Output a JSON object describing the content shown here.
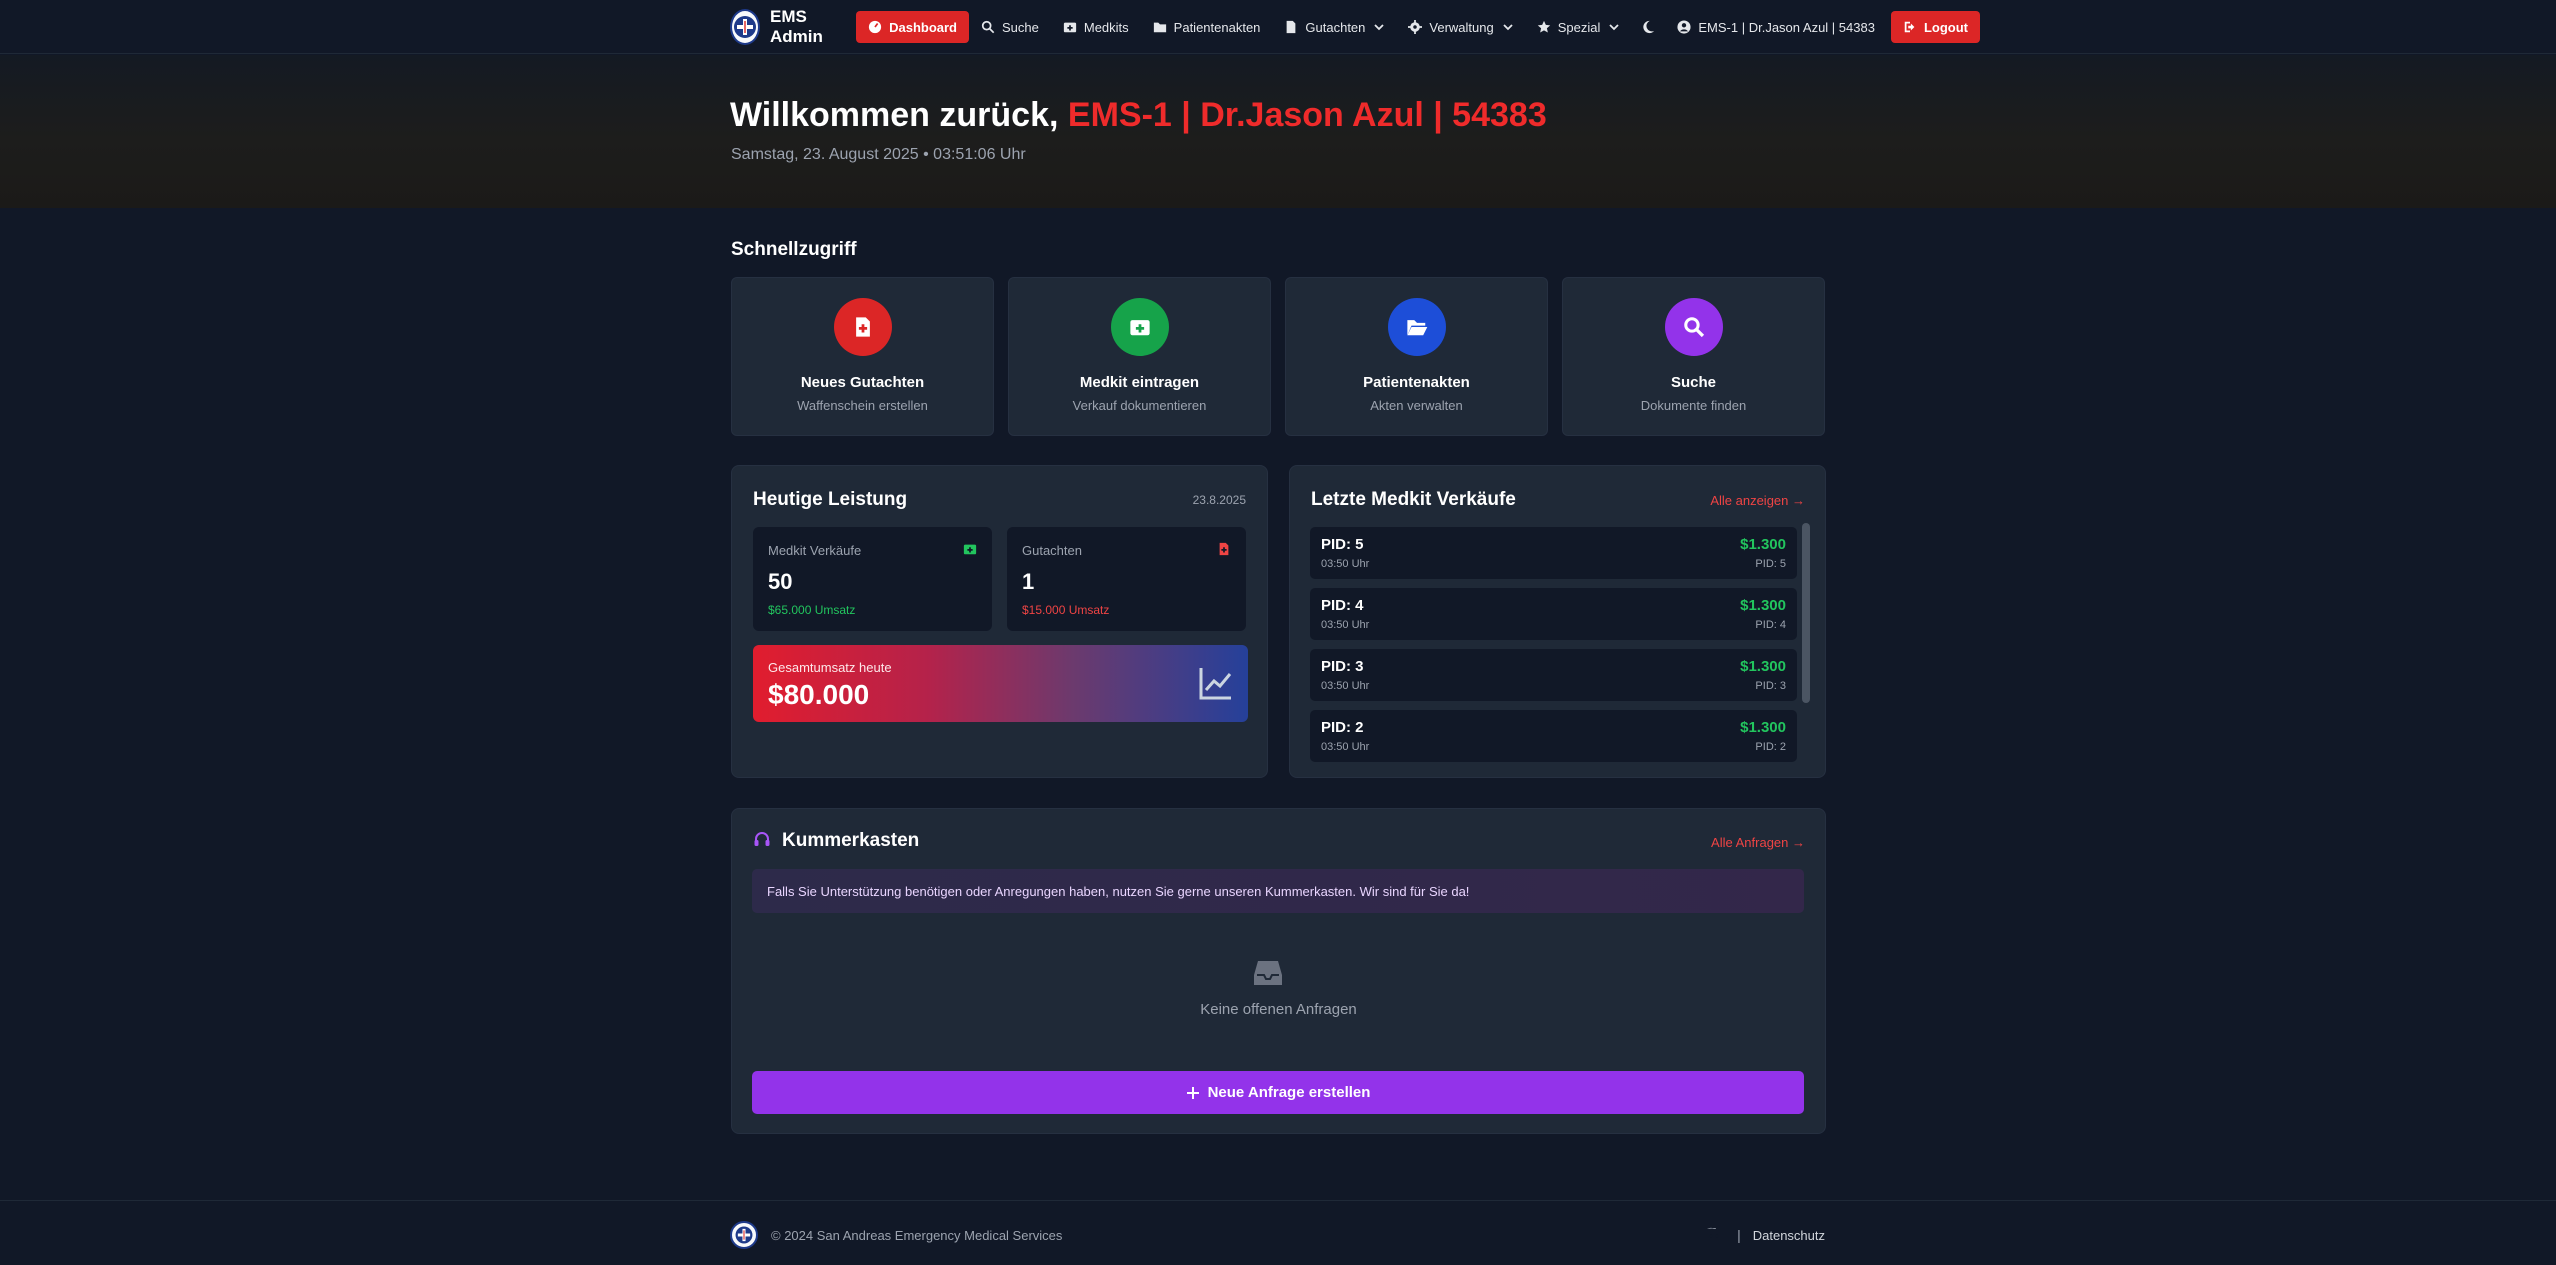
{
  "nav": {
    "brand": "EMS Admin",
    "items": [
      {
        "label": "Dashboard",
        "icon": "dashboard-icon",
        "active": true
      },
      {
        "label": "Suche",
        "icon": "search-icon"
      },
      {
        "label": "Medkits",
        "icon": "medkit-icon"
      },
      {
        "label": "Patientenakten",
        "icon": "folder-icon"
      },
      {
        "label": "Gutachten",
        "icon": "file-icon",
        "dropdown": true
      },
      {
        "label": "Verwaltung",
        "icon": "gear-icon",
        "dropdown": true
      },
      {
        "label": "Spezial",
        "icon": "star-icon",
        "dropdown": true
      }
    ],
    "user": "EMS-1 | Dr.Jason Azul | 54383",
    "logout": "Logout"
  },
  "hero": {
    "greeting": "Willkommen zurück,",
    "name": "EMS-1 | Dr.Jason Azul | 54383",
    "datetime": "Samstag, 23. August 2025 • 03:51:06 Uhr"
  },
  "quick": {
    "title": "Schnellzugriff",
    "cards": [
      {
        "title": "Neues Gutachten",
        "subtitle": "Waffenschein erstellen",
        "icon": "file-plus-icon",
        "color": "#dc2626"
      },
      {
        "title": "Medkit eintragen",
        "subtitle": "Verkauf dokumentieren",
        "icon": "medkit-icon",
        "color": "#16a34a"
      },
      {
        "title": "Patientenakten",
        "subtitle": "Akten verwalten",
        "icon": "folder-open-icon",
        "color": "#1d4ed8"
      },
      {
        "title": "Suche",
        "subtitle": "Dokumente finden",
        "icon": "search-icon",
        "color": "#9333ea"
      }
    ]
  },
  "today": {
    "title": "Heutige Leistung",
    "date": "23.8.2025",
    "medkit": {
      "label": "Medkit Verkäufe",
      "value": "50",
      "revenue": "$65.000 Umsatz"
    },
    "gutachten": {
      "label": "Gutachten",
      "value": "1",
      "revenue": "$15.000 Umsatz"
    },
    "total": {
      "label": "Gesamtumsatz heute",
      "value": "$80.000"
    }
  },
  "sales": {
    "title": "Letzte Medkit Verkäufe",
    "link": "Alle anzeigen →",
    "items": [
      {
        "pid": "PID: 5",
        "time": "03:50 Uhr",
        "amount": "$1.300",
        "pid_small": "PID: 5"
      },
      {
        "pid": "PID: 4",
        "time": "03:50 Uhr",
        "amount": "$1.300",
        "pid_small": "PID: 4"
      },
      {
        "pid": "PID: 3",
        "time": "03:50 Uhr",
        "amount": "$1.300",
        "pid_small": "PID: 3"
      },
      {
        "pid": "PID: 2",
        "time": "03:50 Uhr",
        "amount": "$1.300",
        "pid_small": "PID: 2"
      }
    ]
  },
  "kummer": {
    "title": "Kummerkasten",
    "link": "Alle Anfragen →",
    "notice": "Falls Sie Unterstützung benötigen oder Anregungen haben, nutzen Sie gerne unseren Kummerkasten. Wir sind für Sie da!",
    "empty": "Keine offenen Anfragen",
    "button": "Neue Anfrage erstellen"
  },
  "footer": {
    "copyright": "© 2024 San Andreas Emergency Medical Services",
    "separator": "|",
    "privacy": "Datenschutz"
  }
}
